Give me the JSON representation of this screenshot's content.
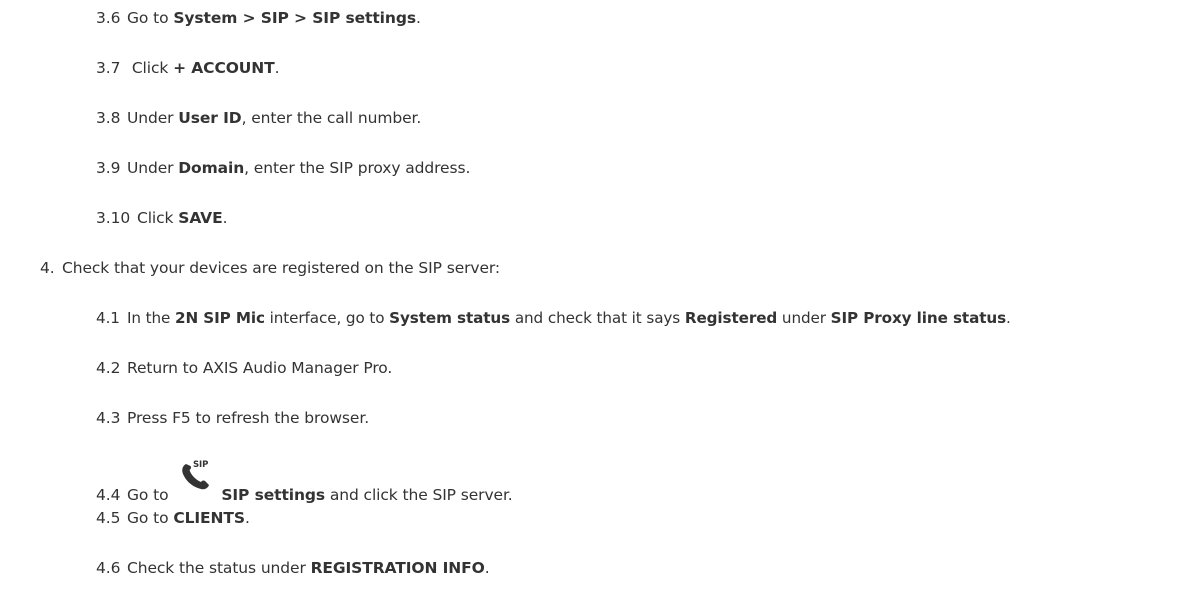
{
  "steps": {
    "s3_6": {
      "num": "3.6",
      "pre": "Go to ",
      "bold1": "System > SIP > SIP settings",
      "post": "."
    },
    "s3_7": {
      "num": "3.7",
      "pre": " Click ",
      "bold1": "+ ACCOUNT",
      "post": "."
    },
    "s3_8": {
      "num": "3.8",
      "pre": "Under ",
      "bold1": "User ID",
      "post": ", enter the call number."
    },
    "s3_9": {
      "num": "3.9",
      "pre": "Under ",
      "bold1": "Domain",
      "post": ", enter the SIP proxy address."
    },
    "s3_10": {
      "num": "3.10",
      "pre": "Click ",
      "bold1": "SAVE",
      "post": "."
    },
    "s4": {
      "num": "4.",
      "text": "Check that your devices are registered on the SIP server:"
    },
    "s4_1": {
      "num": "4.1",
      "pre": "In the ",
      "bold1": "2N SIP Mic",
      "mid1": " interface, go to ",
      "bold2": "System status",
      "mid2": " and check that it says ",
      "bold3": "Registered",
      "mid3": " under ",
      "bold4": "SIP Proxy line status",
      "post": "."
    },
    "s4_2": {
      "num": "4.2",
      "text": "Return to AXIS Audio Manager Pro."
    },
    "s4_3": {
      "num": "4.3",
      "text": "Press F5 to refresh the browser."
    },
    "s4_4": {
      "num": "4.4",
      "pre": "Go to ",
      "icon": "sip-phone-icon",
      "icon_label": "SIP",
      "bold1": "SIP settings",
      "post": " and click the SIP server."
    },
    "s4_5": {
      "num": "4.5",
      "pre": "Go to ",
      "bold1": "CLIENTS",
      "post": "."
    },
    "s4_6": {
      "num": "4.6",
      "pre": "Check the status under ",
      "bold1": "REGISTRATION INFO",
      "post": "."
    }
  }
}
